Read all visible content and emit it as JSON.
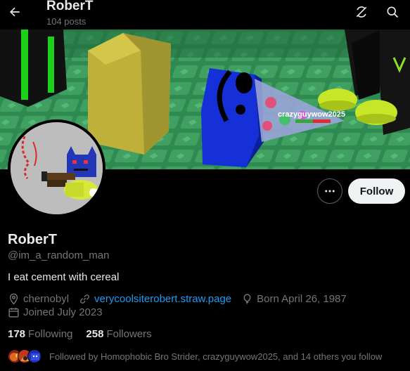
{
  "header": {
    "title": "RoberT",
    "post_count": "104 posts",
    "back_icon": "arrow-left-icon",
    "grok_icon": "grok-icon",
    "search_icon": "search-icon"
  },
  "banner": {
    "player_tag": "crazyguywow2025"
  },
  "actions": {
    "more_label": "...",
    "follow_label": "Follow"
  },
  "profile": {
    "display_name": "RoberT",
    "handle": "@im_a_random_man",
    "bio": "I eat cement with cereal",
    "location": "chernobyl",
    "website": "verycoolsiterobert.straw.page",
    "birthday": "Born April 26, 1987",
    "joined": "Joined July 2023"
  },
  "stats": {
    "following_count": "178",
    "following_label": "Following",
    "followers_count": "258",
    "followers_label": "Followers"
  },
  "followed_by": {
    "text": "Followed by Homophobic Bro Strider, crazyguywow2025, and 14 others you follow"
  },
  "colors": {
    "accent": "#1d9bf0",
    "background": "#000000",
    "muted_text": "#71767b",
    "follow_button_bg": "#eff3f4"
  }
}
